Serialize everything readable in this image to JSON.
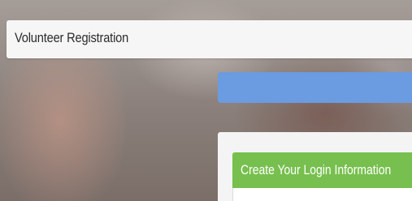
{
  "header": {
    "title": "Volunteer Registration"
  },
  "progress": {
    "color": "#6b9be0"
  },
  "login_panel": {
    "title": "Create Your Login Information",
    "header_color": "#77bf4e"
  }
}
